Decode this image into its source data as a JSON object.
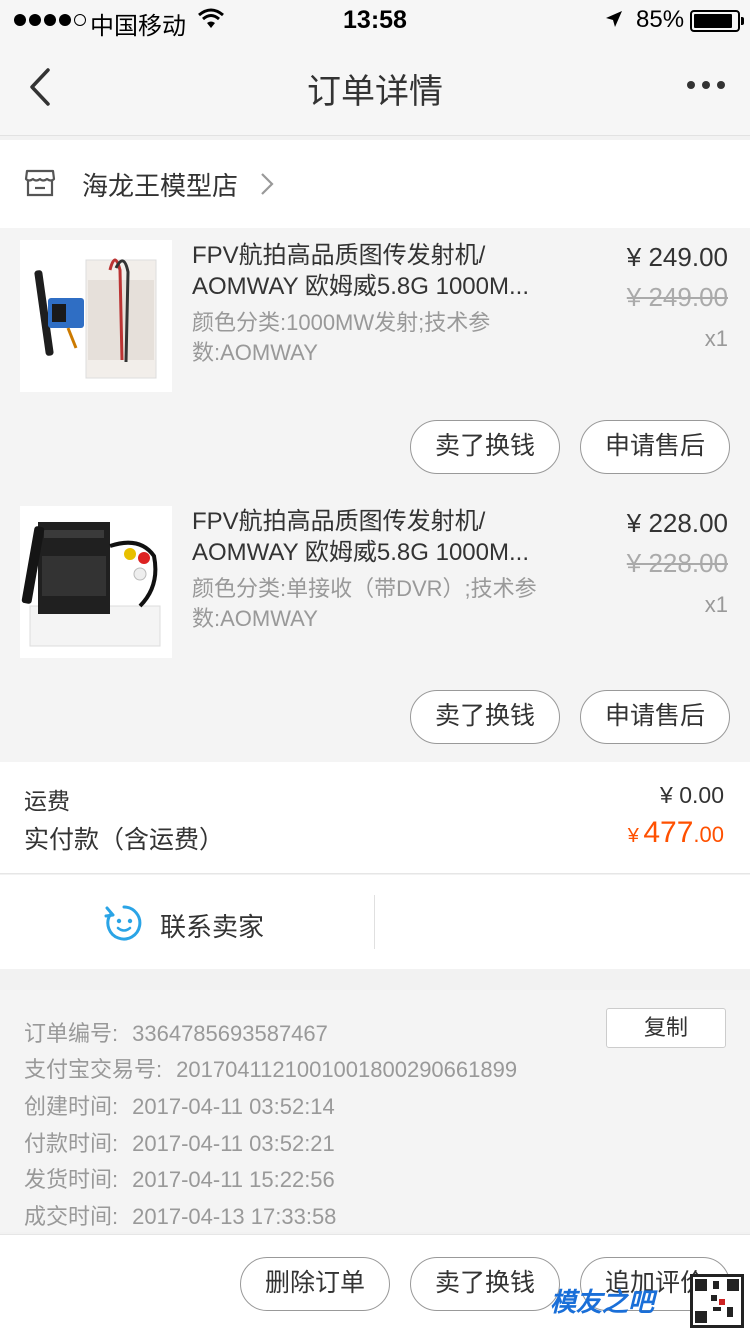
{
  "status": {
    "carrier": "中国移动",
    "time": "13:58",
    "battery": "85%"
  },
  "nav": {
    "title": "订单详情"
  },
  "shop": {
    "name": "海龙王模型店"
  },
  "items": [
    {
      "title": "FPV航拍高品质图传发射机/\nAOMWAY 欧姆威5.8G 1000M...",
      "spec": "颜色分类:1000MW发射;技术参\n数:AOMWAY",
      "price": "¥ 249.00",
      "orig_price": "¥ 249.00",
      "qty": "x1",
      "sell_label": "卖了换钱",
      "aftersale_label": "申请售后"
    },
    {
      "title": "FPV航拍高品质图传发射机/\nAOMWAY 欧姆威5.8G 1000M...",
      "spec": "颜色分类:单接收（带DVR）;技术参\n数:AOMWAY",
      "price": "¥ 228.00",
      "orig_price": "¥ 228.00",
      "qty": "x1",
      "sell_label": "卖了换钱",
      "aftersale_label": "申请售后"
    }
  ],
  "summary": {
    "shipping_label": "运费",
    "shipping_value": "¥ 0.00",
    "paid_label": "实付款（含运费）",
    "paid_currency": "¥",
    "paid_int": "477",
    "paid_dec": ".00"
  },
  "contact": {
    "label": "联系卖家"
  },
  "order_info": {
    "copy_label": "复制",
    "rows": [
      {
        "label": "订单编号:",
        "value": "3364785693587467"
      },
      {
        "label": "支付宝交易号:",
        "value": "2017041121001001800290661899"
      },
      {
        "label": "创建时间:",
        "value": "2017-04-11 03:52:14"
      },
      {
        "label": "付款时间:",
        "value": "2017-04-11 03:52:21"
      },
      {
        "label": "发货时间:",
        "value": "2017-04-11 15:22:56"
      },
      {
        "label": "成交时间:",
        "value": "2017-04-13 17:33:58"
      }
    ]
  },
  "bottom": {
    "delete_label": "删除订单",
    "sell_label": "卖了换钱",
    "review_label": "追加评价"
  },
  "watermark": {
    "text": "模友之吧"
  },
  "colors": {
    "accent": "#ff5000",
    "contact_icon": "#2aa4e6",
    "watermark": "#1a6fd8"
  }
}
